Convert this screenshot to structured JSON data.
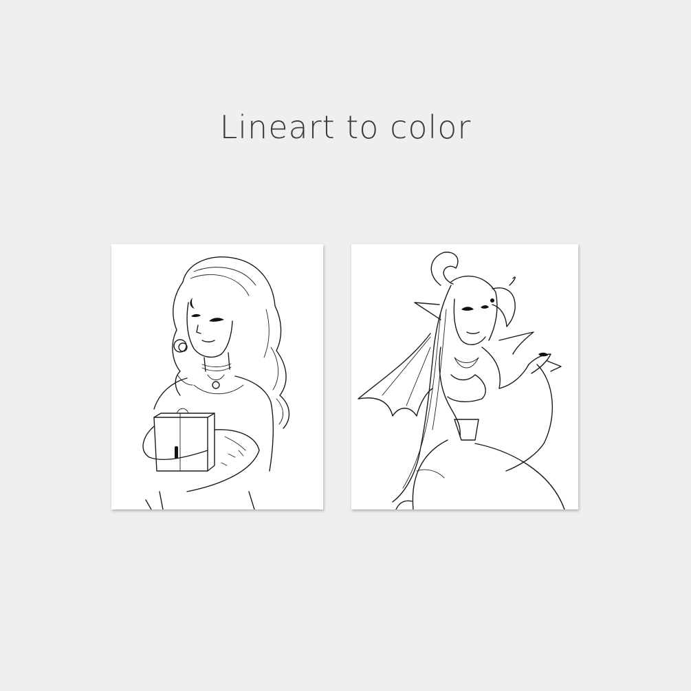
{
  "title": "Lineart to color",
  "artworks": [
    {
      "icon": "lineart-woman-holding-box"
    },
    {
      "icon": "lineart-demon-girl-with-wings"
    }
  ]
}
